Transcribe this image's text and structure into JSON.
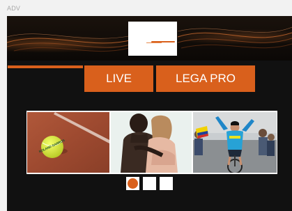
{
  "ad_label": "ADV",
  "nav": {
    "tabs": [
      {
        "label": "LIVE"
      },
      {
        "label": "LEGA PRO"
      }
    ]
  },
  "slides": [
    {
      "subject": "Roland Garros tennis ball on clay",
      "ball_text": "ROLAND GARROS"
    },
    {
      "subject": "couple portrait"
    },
    {
      "subject": "cyclist celebrating at finish"
    }
  ],
  "pagination": {
    "count": 3,
    "active": 1
  },
  "colors": {
    "accent": "#d9601c",
    "panel": "#111111",
    "page": "#f2f2f2"
  }
}
